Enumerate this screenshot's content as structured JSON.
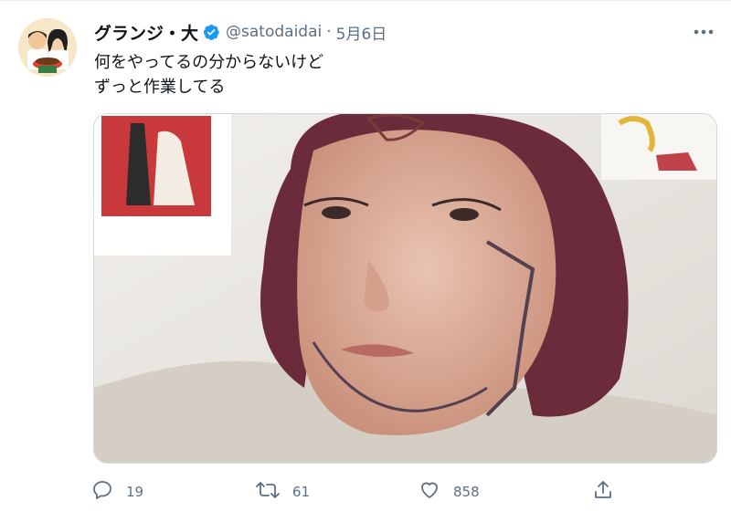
{
  "tweet": {
    "display_name": "グランジ・大",
    "handle": "@satodaidai",
    "separator": "·",
    "date": "5月6日",
    "text_lines": [
      "何をやってるの分からないけど",
      "ずっと作業してる"
    ]
  },
  "actions": {
    "reply_count": "19",
    "retweet_count": "61",
    "like_count": "858"
  },
  "icons": {
    "verified": "verified-badge-icon",
    "more": "more-icon",
    "reply": "reply-icon",
    "retweet": "retweet-icon",
    "like": "heart-icon",
    "share": "share-icon"
  },
  "colors": {
    "verified": "#1d9bf0",
    "secondary_text": "#5b7083",
    "primary_text": "#0f1419"
  }
}
